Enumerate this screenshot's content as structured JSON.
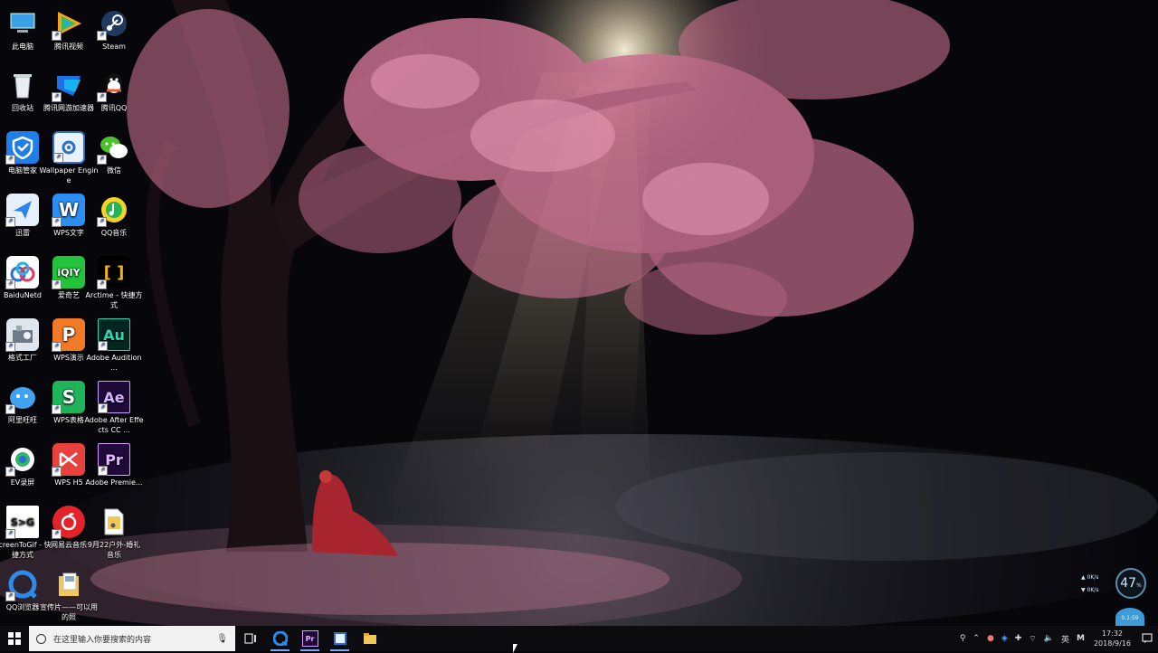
{
  "desktop": {
    "icons": [
      {
        "label": "此电脑",
        "icon": "computer-icon"
      },
      {
        "label": "腾讯视频",
        "icon": "tencent-video-icon"
      },
      {
        "label": "Steam",
        "icon": "steam-icon"
      },
      {
        "label": "回收站",
        "icon": "recycle-bin-icon"
      },
      {
        "label": "腾讯网游加速器",
        "icon": "game-accelerator-icon"
      },
      {
        "label": "腾讯QQ",
        "icon": "qq-icon"
      },
      {
        "label": "电脑管家",
        "icon": "pc-manager-icon"
      },
      {
        "label": "Wallpaper Engine",
        "icon": "wallpaper-engine-icon"
      },
      {
        "label": "微信",
        "icon": "wechat-icon"
      },
      {
        "label": "迅雷",
        "icon": "thunder-icon"
      },
      {
        "label": "WPS文字",
        "icon": "wps-writer-icon"
      },
      {
        "label": "QQ音乐",
        "icon": "qq-music-icon"
      },
      {
        "label": "BaiduNetd",
        "icon": "baidu-netdisk-icon"
      },
      {
        "label": "爱奇艺",
        "icon": "iqiyi-icon"
      },
      {
        "label": "Arctime - 快捷方式",
        "icon": "arctime-icon"
      },
      {
        "label": "格式工厂",
        "icon": "format-factory-icon"
      },
      {
        "label": "WPS演示",
        "icon": "wps-presentation-icon"
      },
      {
        "label": "Adobe Audition ...",
        "icon": "adobe-audition-icon"
      },
      {
        "label": "阿里旺旺",
        "icon": "aliwangwang-icon"
      },
      {
        "label": "WPS表格",
        "icon": "wps-spreadsheet-icon"
      },
      {
        "label": "Adobe After Effects CC ...",
        "icon": "adobe-after-effects-icon"
      },
      {
        "label": "EV录屏",
        "icon": "ev-recorder-icon"
      },
      {
        "label": "WPS H5",
        "icon": "wps-h5-icon"
      },
      {
        "label": "Adobe Premie...",
        "icon": "adobe-premiere-icon"
      },
      {
        "label": "ScreenToGif - 快捷方式",
        "icon": "screentogif-icon"
      },
      {
        "label": "网易云音乐",
        "icon": "netease-music-icon"
      },
      {
        "label": "9月22户外-婚礼音乐",
        "icon": "audio-file-icon"
      },
      {
        "label": "QQ浏览器",
        "icon": "qq-browser-icon"
      },
      {
        "label": "宣传片——可以用的照",
        "icon": "folder-icon"
      }
    ],
    "glyphs": {
      "wps_w": "W",
      "wps_p": "P",
      "wps_s": "S",
      "iqiyi": "iQIY",
      "au": "Au",
      "ae": "Ae",
      "pr": "Pr",
      "arctime": "[ ]",
      "s2g": "S>G"
    }
  },
  "taskbar": {
    "search_placeholder": "在这里输入你要搜索的内容",
    "apps": [
      {
        "icon": "task-view-icon"
      },
      {
        "icon": "edge-browser-icon"
      },
      {
        "icon": "premiere-taskbar-icon",
        "glyph": "Pr"
      },
      {
        "icon": "wallpaper-engine-taskbar-icon"
      },
      {
        "icon": "file-explorer-icon"
      }
    ],
    "tray": {
      "ime": "英",
      "ime2": "M",
      "time": "17:32",
      "date": "2018/9/16"
    }
  },
  "netmon": {
    "up": "0K/s",
    "down": "0K/s",
    "percent": "47",
    "percent_unit": "%",
    "ball_text": "0.1:59"
  },
  "colors": {
    "taskbar_bg": "#0b0b10",
    "search_bg": "#f2f2f2",
    "blossom": "#c8708f"
  }
}
